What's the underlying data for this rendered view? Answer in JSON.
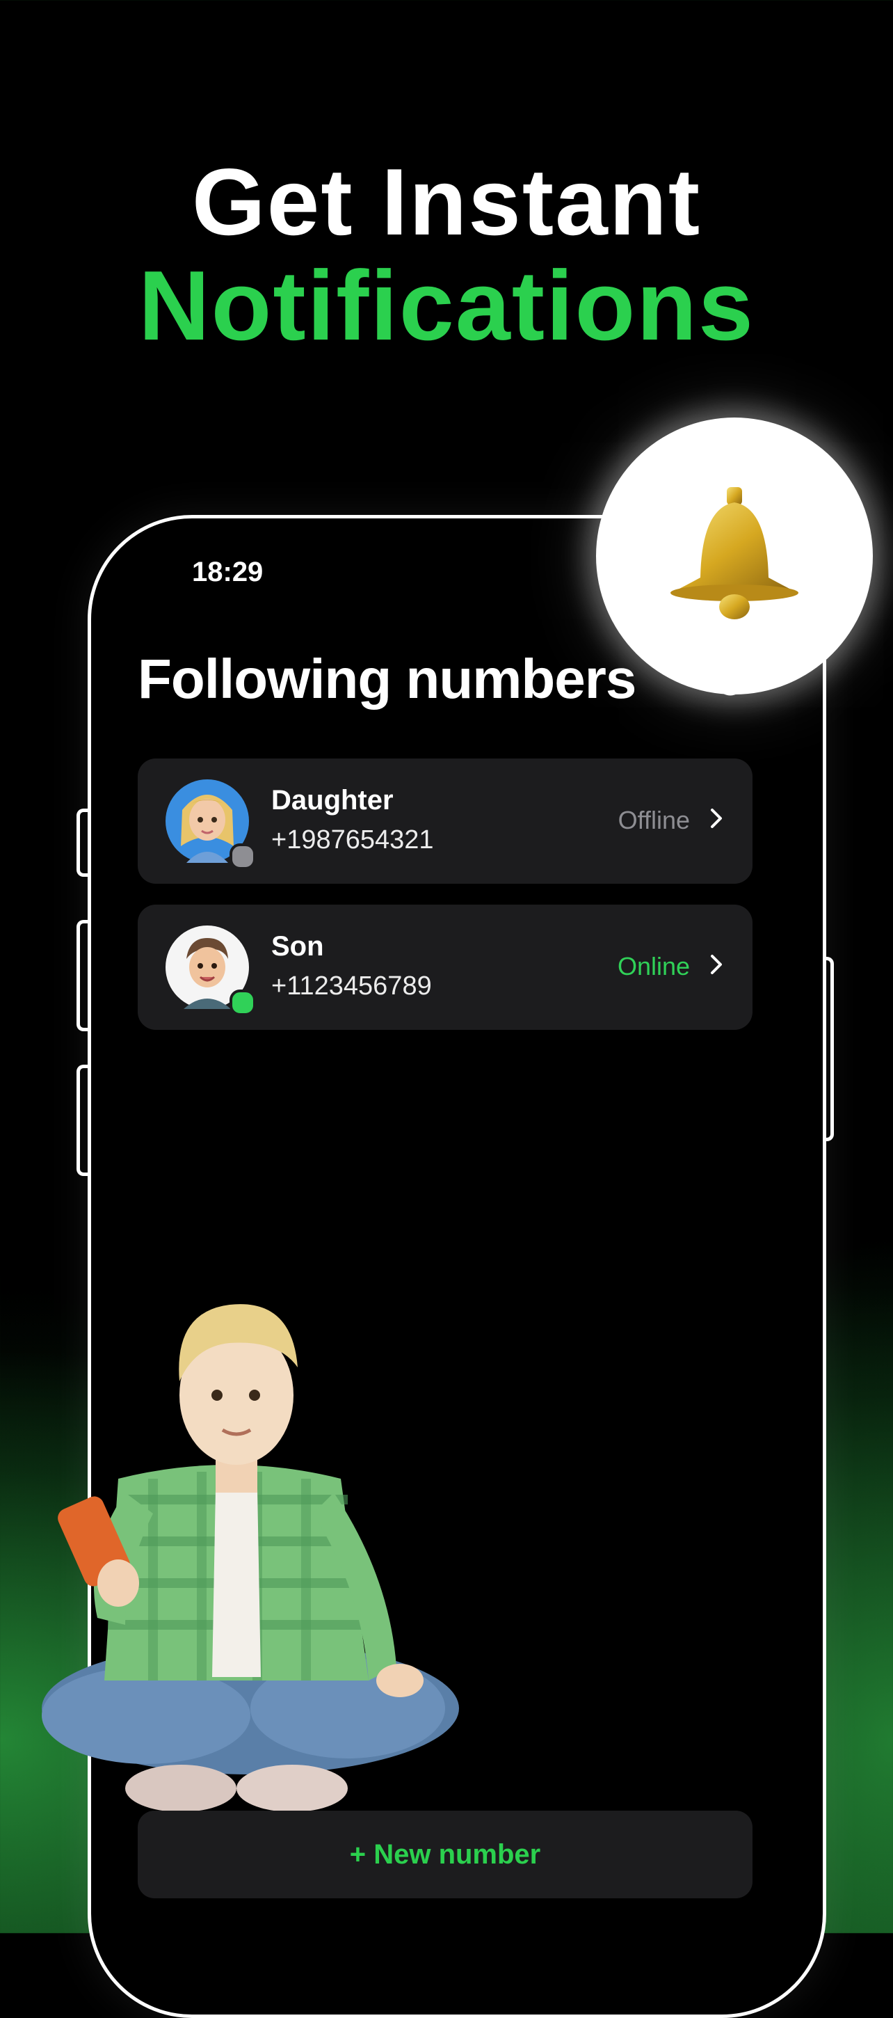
{
  "headline": {
    "line1": "Get Instant",
    "line2": "Notifications"
  },
  "status_bar": {
    "time": "18:29"
  },
  "screen": {
    "title": "Following numbers"
  },
  "contacts": [
    {
      "name": "Daughter",
      "number": "+1987654321",
      "status": "Offline",
      "status_color": "#8e8e93",
      "dot_color": "#8e8e93",
      "avatar": "girl-avatar"
    },
    {
      "name": "Son",
      "number": "+1123456789",
      "status": "Online",
      "status_color": "#30d158",
      "dot_color": "#30d158",
      "avatar": "boy-avatar"
    }
  ],
  "actions": {
    "new_number": "+ New number"
  },
  "colors": {
    "accent": "#2bd04e",
    "card": "#1c1c1e",
    "background": "#000000"
  },
  "icons": {
    "bell": "bell-icon",
    "chevron": "chevron-right-icon"
  }
}
